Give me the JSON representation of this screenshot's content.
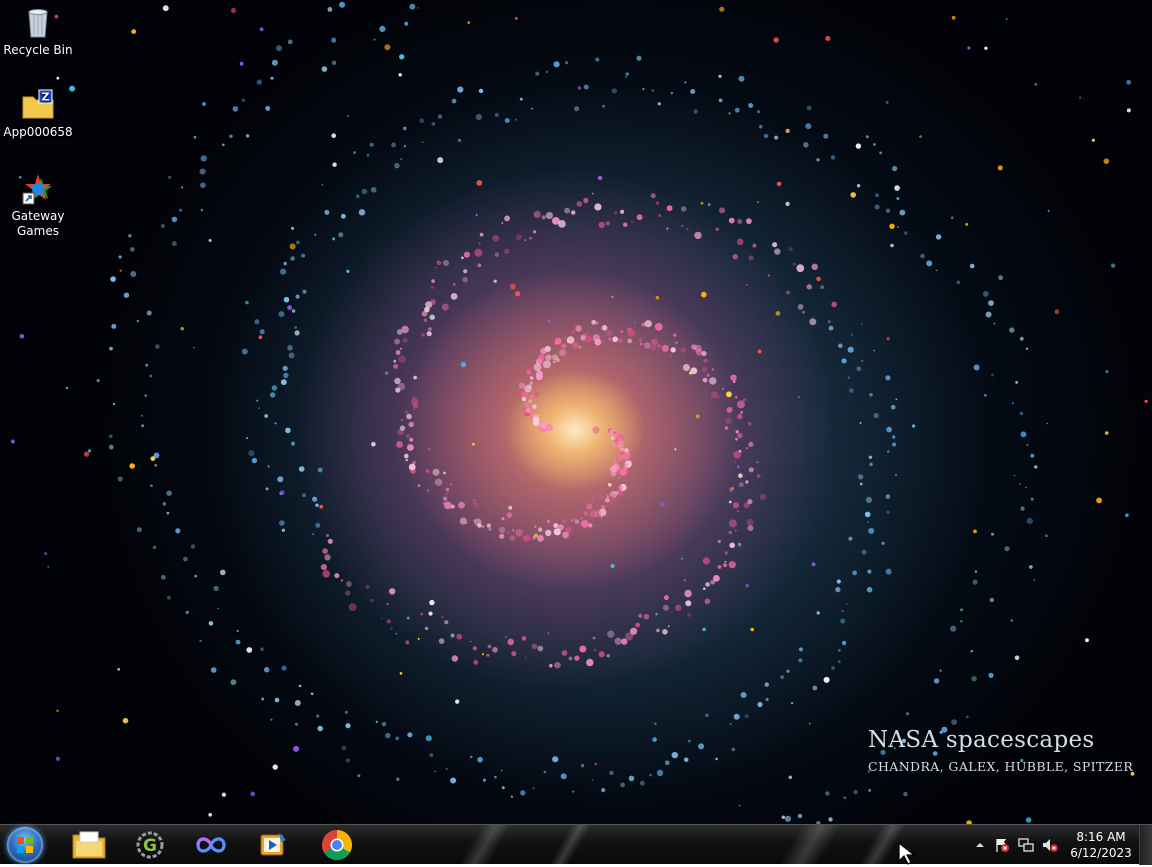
{
  "desktop": {
    "icons": [
      {
        "label": "Recycle Bin",
        "icon": "recycle-bin-icon"
      },
      {
        "label": "App000658",
        "icon": "zip-folder-icon"
      },
      {
        "label": "Gateway Games",
        "icon": "gateway-games-icon"
      }
    ],
    "wallpaper": {
      "title": "NASA spacescapes",
      "subtitle": "CHANDRA, GALEX, HUBBLE, SPITZER"
    }
  },
  "taskbar": {
    "start": {
      "icon": "windows-start-orb"
    },
    "pinned": [
      {
        "name": "file-explorer",
        "icon": "folder-icon"
      },
      {
        "name": "app-g",
        "icon": "g-logo-icon"
      },
      {
        "name": "app-infinity",
        "icon": "infinity-icon"
      },
      {
        "name": "app-media",
        "icon": "media-player-icon"
      },
      {
        "name": "google-chrome",
        "icon": "chrome-icon"
      }
    ],
    "tray": {
      "icons": [
        "show-hidden-icons-arrow",
        "action-center-flag-icon",
        "network-icon",
        "volume-muted-icon"
      ],
      "time": "8:16 AM",
      "date": "6/12/2023"
    }
  },
  "colors": {
    "taskbar_bg": "#111111",
    "text": "#ffffff",
    "watermark": "#d7dde6"
  }
}
